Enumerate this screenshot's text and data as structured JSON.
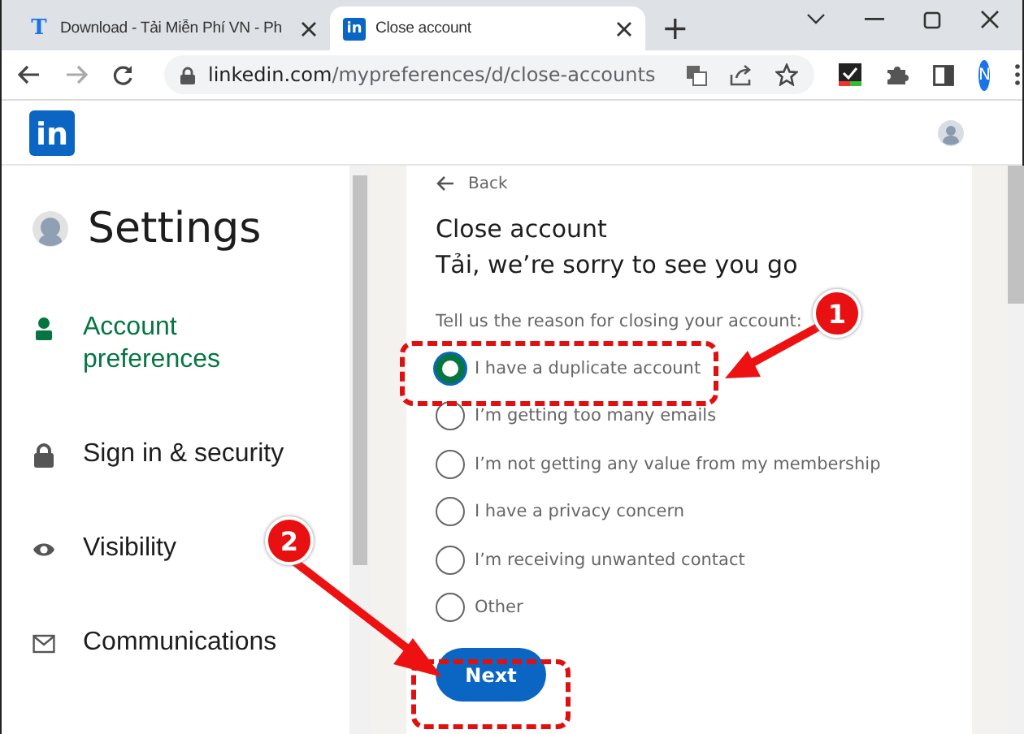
{
  "browser": {
    "tabs": [
      {
        "title": "Download - Tải Miễn Phí VN - Ph",
        "favicon": "T",
        "selected": false
      },
      {
        "title": "Close account",
        "favicon": "in",
        "selected": true
      }
    ],
    "new_tab": "+",
    "address": {
      "host": "linkedin.com",
      "path": "/mypreferences/d/close-accounts"
    },
    "profile": "N"
  },
  "header": {
    "logo": "in"
  },
  "sidebar": {
    "title": "Settings",
    "items": [
      {
        "label": "Account preferences",
        "kind": "person",
        "selected": true
      },
      {
        "label": "Sign in & security",
        "kind": "lock",
        "selected": false
      },
      {
        "label": "Visibility",
        "kind": "eye",
        "selected": false
      },
      {
        "label": "Communications",
        "kind": "mail",
        "selected": false
      }
    ]
  },
  "card": {
    "back": "Back",
    "title": "Close account",
    "subtitle": "Tải, we’re sorry to see you go",
    "prompt": "Tell us the reason for closing your account:",
    "reasons": [
      {
        "label": "I have a duplicate account",
        "selected": true
      },
      {
        "label": "I’m getting too many emails",
        "selected": false
      },
      {
        "label": "I’m not getting any value from my membership",
        "selected": false
      },
      {
        "label": "I have a privacy concern",
        "selected": false
      },
      {
        "label": "I’m receiving unwanted contact",
        "selected": false
      },
      {
        "label": "Other",
        "selected": false
      }
    ],
    "button": "Next"
  },
  "annotations": [
    {
      "number": "1"
    },
    {
      "number": "2"
    }
  ]
}
